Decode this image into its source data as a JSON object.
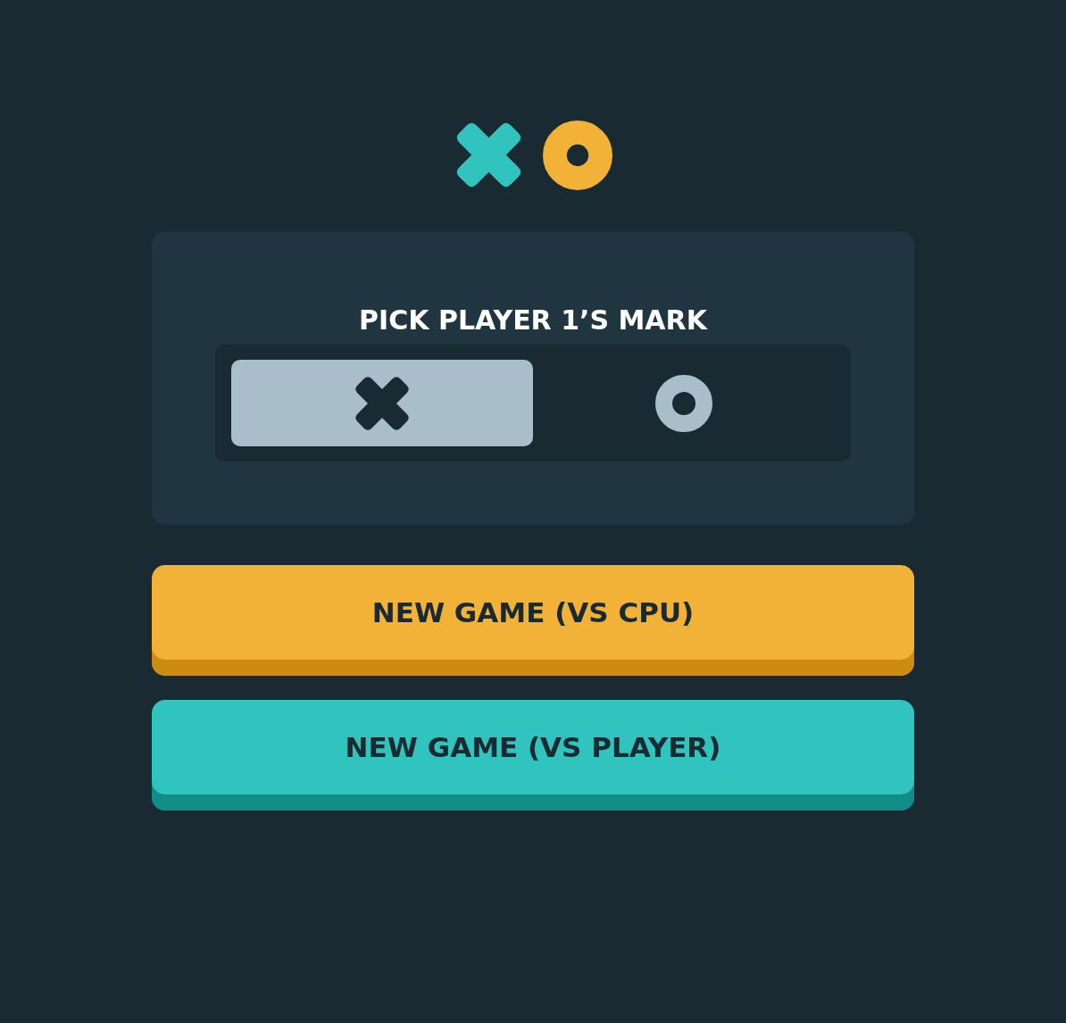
{
  "picker": {
    "title": "PICK PLAYER 1’S MARK",
    "options": [
      {
        "kind": "x",
        "selected": true
      },
      {
        "kind": "o",
        "selected": false
      }
    ]
  },
  "buttons": [
    {
      "kind": "cpu",
      "label": "NEW GAME (VS CPU)"
    },
    {
      "kind": "player",
      "label": "NEW GAME (VS PLAYER)"
    }
  ]
}
